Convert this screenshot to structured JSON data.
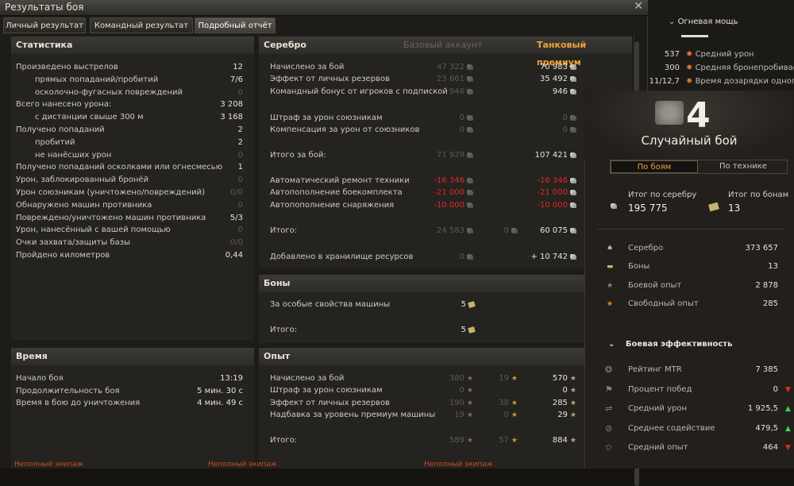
{
  "window": {
    "title": "Результаты боя",
    "close": "✕"
  },
  "tabs": [
    "Личный результат",
    "Командный результат",
    "Подробный отчёт"
  ],
  "stats": {
    "heading": "Статистика",
    "rows": [
      {
        "label": "Произведено выстрелов",
        "value": "12",
        "indent": false,
        "dim": false
      },
      {
        "label": "прямых попаданий/пробитий",
        "value": "7/6",
        "indent": true,
        "dim": false
      },
      {
        "label": "осколочно-фугасных повреждений",
        "value": "0",
        "indent": true,
        "dim": true
      },
      {
        "label": "Всего нанесено урона:",
        "value": "3 208",
        "indent": false,
        "dim": false
      },
      {
        "label": "с дистанции свыше 300 м",
        "value": "3 168",
        "indent": true,
        "dim": false
      },
      {
        "label": "Получено попаданий",
        "value": "2",
        "indent": false,
        "dim": false
      },
      {
        "label": "пробитий",
        "value": "2",
        "indent": true,
        "dim": false
      },
      {
        "label": "не нанёсших урон",
        "value": "0",
        "indent": true,
        "dim": true
      },
      {
        "label": "Получено попаданий осколками или огнесмесью",
        "value": "1",
        "indent": false,
        "dim": false
      },
      {
        "label": "Урон, заблокированный бронёй",
        "value": "0",
        "indent": false,
        "dim": true
      },
      {
        "label": "Урон союзникам (уничтожено/повреждений)",
        "value": "0/0",
        "indent": false,
        "dim": true
      },
      {
        "label": "Обнаружено машин противника",
        "value": "0",
        "indent": false,
        "dim": true
      },
      {
        "label": "Повреждено/уничтожено машин противника",
        "value": "5/3",
        "indent": false,
        "dim": false
      },
      {
        "label": "Урон, нанесённый с вашей помощью",
        "value": "0",
        "indent": false,
        "dim": true
      },
      {
        "label": "Очки захвата/защиты базы",
        "value": "0/0",
        "indent": false,
        "dim": true
      },
      {
        "label": "Пройдено километров",
        "value": "0,44",
        "indent": false,
        "dim": false
      }
    ]
  },
  "time": {
    "heading": "Время",
    "rows": [
      {
        "label": "Начало боя",
        "value": "13:19"
      },
      {
        "label": "Продолжительность боя",
        "value": "5 мин. 30 с"
      },
      {
        "label": "Время в бою до уничтожения",
        "value": "4 мин. 49 с"
      }
    ]
  },
  "silver": {
    "heading": "Серебро",
    "col_base": "Базовый аккаунт",
    "col_prem": "Танковый премиум",
    "rows": [
      {
        "label": "Начислено за бой",
        "base": "47 322",
        "prem": "70 983",
        "red": false
      },
      {
        "label": "Эффект от личных резервов",
        "base": "23 661",
        "prem": "35 492",
        "red": false
      },
      {
        "label": "Командный бонус от игроков с подпиской",
        "base": "946",
        "prem": "946",
        "red": false
      },
      {
        "label": "Штраф за урон союзникам",
        "base": "0",
        "prem": "0",
        "red": false,
        "dimprem": true
      },
      {
        "label": "Компенсация за урон от союзников",
        "base": "0",
        "prem": "0",
        "red": false,
        "dimprem": true
      },
      {
        "label": "Итого за бой:",
        "base": "71 929",
        "prem": "107 421",
        "red": false
      },
      {
        "label": "Автоматический ремонт техники",
        "base": "-16 346",
        "prem": "-16 346",
        "red": true
      },
      {
        "label": "Автопополнение боекомплекта",
        "base": "-21 000",
        "prem": "-21 000",
        "red": true
      },
      {
        "label": "Автопополнение снаряжения",
        "base": "-10 000",
        "prem": "-10 000",
        "red": true
      },
      {
        "label": "Итого:",
        "base": "24 583",
        "mid": "0",
        "prem": "60 075",
        "red": false
      },
      {
        "label": "Добавлено в хранилище ресурсов",
        "base": "0",
        "prem": "+ 10 742",
        "red": false
      }
    ]
  },
  "bonds": {
    "heading": "Боны",
    "rows": [
      {
        "label": "За особые свойства машины",
        "value": "5"
      },
      {
        "label": "Итого:",
        "value": "5"
      }
    ]
  },
  "xp": {
    "heading": "Опыт",
    "rows": [
      {
        "label": "Начислено за бой",
        "base": "380",
        "mid": "19",
        "prem": "570"
      },
      {
        "label": "Штраф за урон союзникам",
        "base": "0",
        "mid": "",
        "prem": "0"
      },
      {
        "label": "Эффект от личных резервов",
        "base": "190",
        "mid": "38",
        "prem": "285"
      },
      {
        "label": "Надбавка за уровень премиум машины",
        "base": "19",
        "mid": "0",
        "prem": "29"
      },
      {
        "label": "Итого:",
        "base": "589",
        "mid": "57",
        "prem": "884"
      }
    ]
  },
  "bottom_labels": [
    "Неполный экипаж",
    "Неполный экипаж",
    "Неполный экипаж"
  ],
  "bg": {
    "tier": "23"
  },
  "topright": {
    "title": "Огневая мощь",
    "rows": [
      {
        "value": "537",
        "label": "Средний урон"
      },
      {
        "value": "300",
        "label": "Средняя бронепробиваемо"
      },
      {
        "value": "11/12,7",
        "label": "Время дозарядки одного с"
      }
    ]
  },
  "summary": {
    "battles": "4",
    "battle_type": "Случайный бой",
    "tab_battles": "По боям",
    "tab_vehicles": "По технике",
    "silver_total_label": "Итог по серебру",
    "silver_total": "195 775",
    "bonds_total_label": "Итог по бонам",
    "bonds_total": "13",
    "rows": [
      {
        "label": "Серебро",
        "value": "373 657"
      },
      {
        "label": "Боны",
        "value": "13"
      },
      {
        "label": "Боевой опыт",
        "value": "2 878"
      },
      {
        "label": "Свободный опыт",
        "value": "285"
      }
    ],
    "eff_heading": "Боевая эффективность",
    "eff": [
      {
        "label": "Рейтинг MTR",
        "value": "7 385",
        "trend": ""
      },
      {
        "label": "Процент побед",
        "value": "0",
        "trend": "down"
      },
      {
        "label": "Средний урон",
        "value": "1 925,5",
        "trend": "up"
      },
      {
        "label": "Среднее содействие",
        "value": "479,5",
        "trend": "up"
      },
      {
        "label": "Средний опыт",
        "value": "464",
        "trend": "down"
      }
    ]
  }
}
